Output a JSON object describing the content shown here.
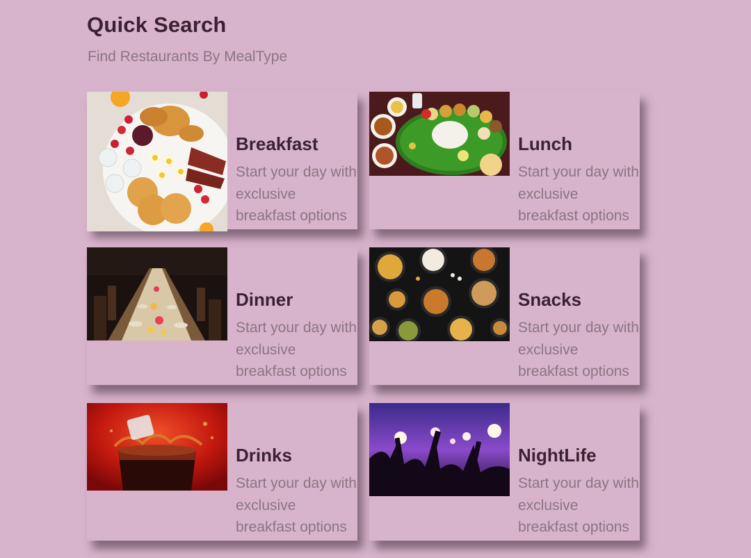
{
  "header": {
    "title": "Quick Search",
    "subtitle": "Find Restaurants By MealType"
  },
  "meals": [
    {
      "title": "Breakfast",
      "description": "Start your day with exclusive breakfast options",
      "image": "breakfast-platter-image"
    },
    {
      "title": "Lunch",
      "description": "Start your day with exclusive breakfast options",
      "image": "lunch-thali-image"
    },
    {
      "title": "Dinner",
      "description": "Start your day with exclusive breakfast options",
      "image": "dinner-table-image"
    },
    {
      "title": "Snacks",
      "description": "Start your day with exclusive breakfast options",
      "image": "snack-bowls-image"
    },
    {
      "title": "Drinks",
      "description": "Start your day with exclusive breakfast options",
      "image": "cola-glass-image"
    },
    {
      "title": "NightLife",
      "description": "Start your day with exclusive breakfast options",
      "image": "concert-crowd-image"
    }
  ]
}
